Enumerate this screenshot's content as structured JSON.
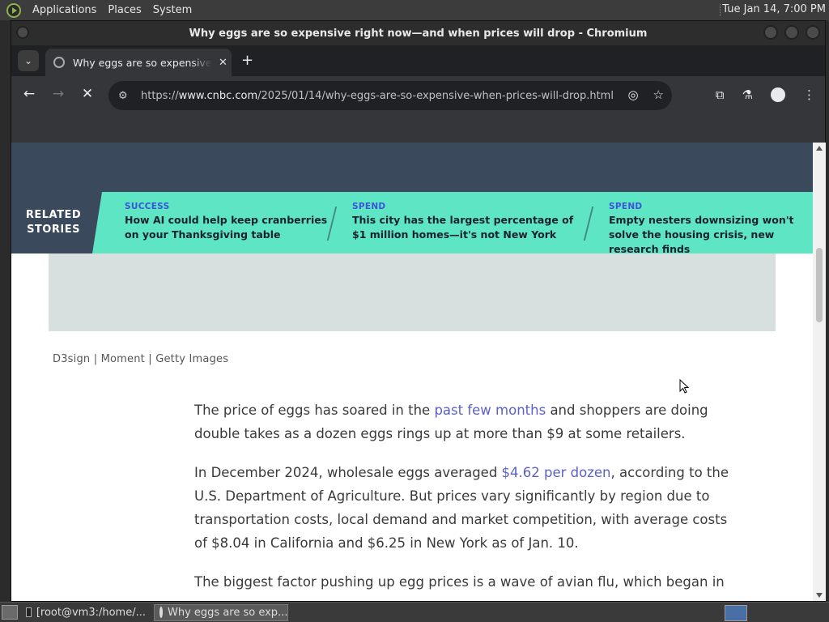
{
  "top_panel": {
    "menus": [
      "Applications",
      "Places",
      "System"
    ],
    "clock": "Tue Jan 14,  7:00 PM"
  },
  "window": {
    "title": "Why eggs are so expensive right now—and when prices will drop - Chromium"
  },
  "tab": {
    "title": "Why eggs are so expensive right now—and when prices will drop",
    "close": "✕",
    "new_tab": "+"
  },
  "toolbar": {
    "url_prefix": "https://",
    "url_host": "www.cnbc.com",
    "url_path": "/2025/01/14/why-eggs-are-so-expensive-when-prices-will-drop.html"
  },
  "related": {
    "label_line1": "RELATED",
    "label_line2": "STORIES",
    "cards": [
      {
        "category": "SUCCESS",
        "headline": "How AI could help keep cranberries on your Thanksgiving table"
      },
      {
        "category": "SPEND",
        "headline": "This city has the largest percentage of $1 million homes—it's not New York"
      },
      {
        "category": "SPEND",
        "headline": "Empty nesters downsizing won't solve the housing crisis, new research finds"
      }
    ]
  },
  "article": {
    "photo_credit": "D3sign | Moment | Getty Images",
    "p1_a": "The price of eggs has soared in the ",
    "p1_link": "past few months",
    "p1_b": " and shoppers are doing double takes as a dozen eggs rings up at more than $9 at some retailers.",
    "p2_a": "In December 2024, wholesale eggs averaged ",
    "p2_link": "$4.62 per dozen",
    "p2_b": ", according to the U.S. Department of Agriculture. But prices vary significantly by region due to transportation costs, local demand and market competition, with average costs of $8.04 in California and $6.25 in New York as of Jan. 10.",
    "p3": "The biggest factor pushing up egg prices is a wave of avian flu, which began in"
  },
  "taskbar": {
    "tasks": [
      "[root@vm3:/home/...",
      "Why eggs are so exp..."
    ]
  }
}
